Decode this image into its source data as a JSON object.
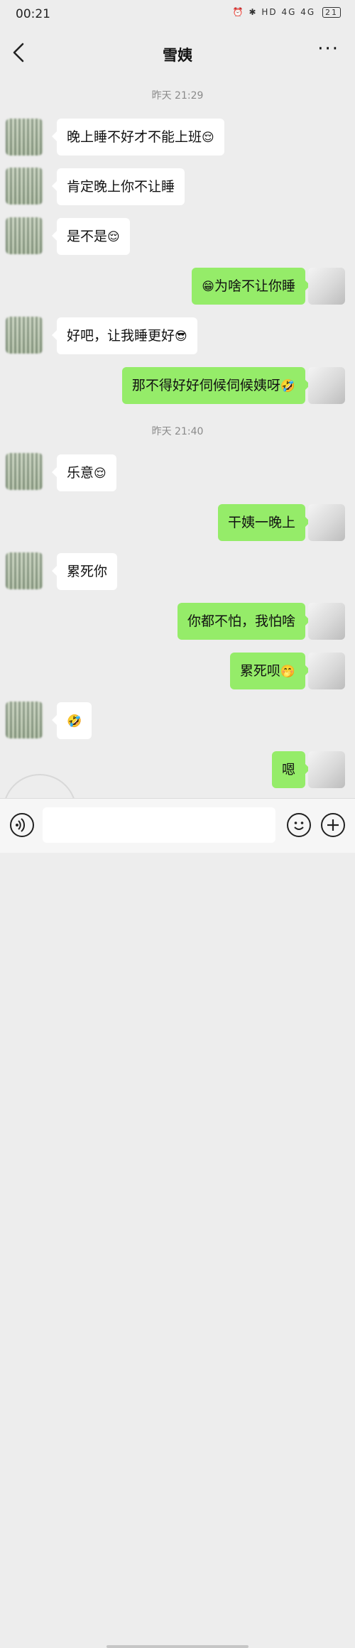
{
  "status_bar": {
    "time": "00:21",
    "icons": "⏰ ✱ HD 4G 4G",
    "battery": "21"
  },
  "header": {
    "title": "雪姨",
    "more": "···"
  },
  "timestamps": [
    "昨天 21:29",
    "昨天 21:40"
  ],
  "messages": [
    {
      "side": "left",
      "text": "晚上睡不好才不能上班",
      "emoji": "😌"
    },
    {
      "side": "left",
      "text": "肯定晚上你不让睡",
      "emoji": ""
    },
    {
      "side": "left",
      "text": "是不是",
      "emoji": "😌"
    },
    {
      "side": "right",
      "text": "为啥不让你睡",
      "emoji_before": "😁"
    },
    {
      "side": "left",
      "text": "好吧，让我睡更好",
      "emoji": "😎"
    },
    {
      "side": "right",
      "text": "那不得好好伺候伺候姨呀",
      "emoji": "🤣"
    },
    {
      "side": "left",
      "text": "乐意",
      "emoji": "😌"
    },
    {
      "side": "right",
      "text": "干姨一晚上",
      "emoji": ""
    },
    {
      "side": "left",
      "text": "累死你",
      "emoji": ""
    },
    {
      "side": "right",
      "text": "你都不怕，我怕啥",
      "emoji": ""
    },
    {
      "side": "right",
      "text": "累死呗",
      "emoji": "🤭"
    },
    {
      "side": "left",
      "text": "",
      "emoji": "🤣"
    },
    {
      "side": "right",
      "text": "嗯",
      "emoji": ""
    }
  ],
  "input": {
    "placeholder": ""
  },
  "icons": {
    "back": "back-arrow-icon",
    "voice": "voice-icon",
    "emoji": "emoji-icon",
    "plus": "plus-icon"
  },
  "colors": {
    "self_bubble": "#95ec69",
    "other_bubble": "#ffffff",
    "background": "#ededed"
  }
}
